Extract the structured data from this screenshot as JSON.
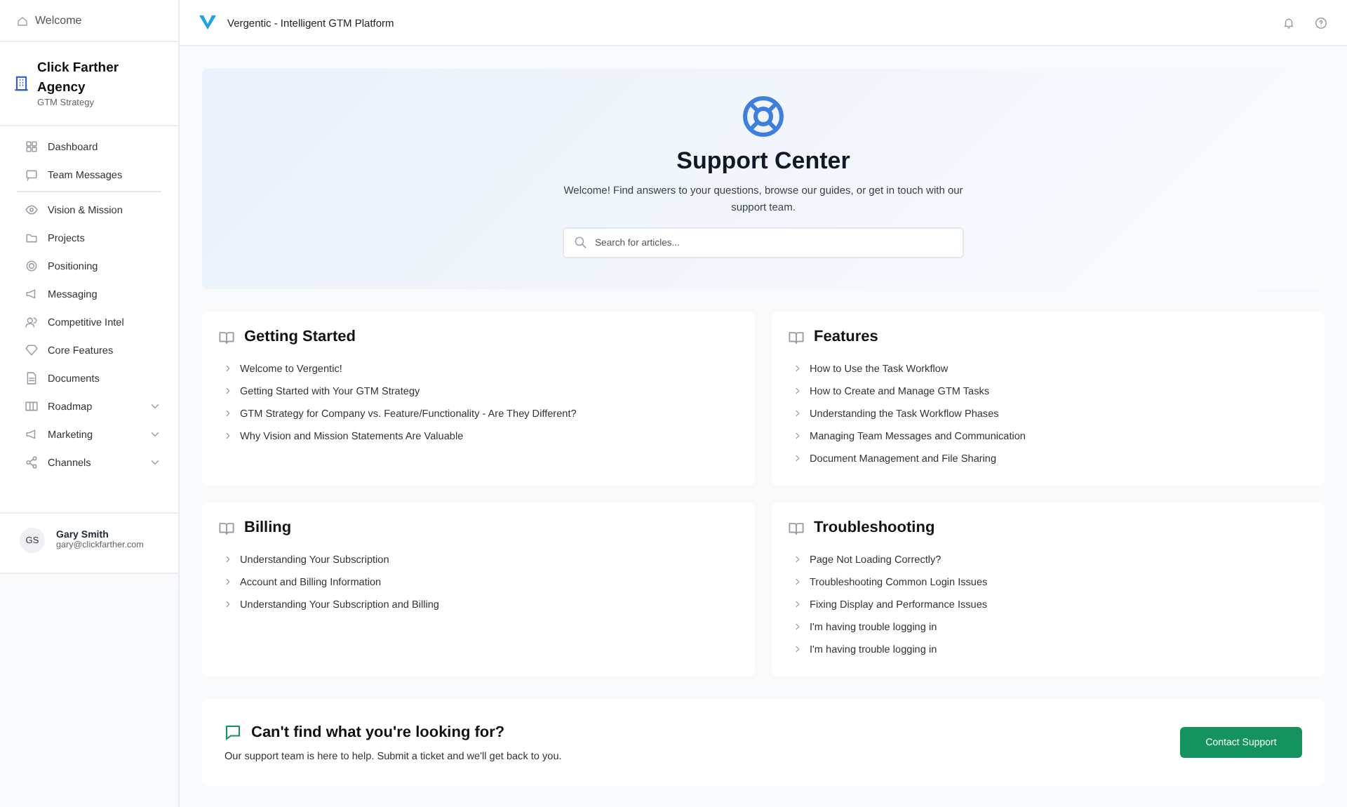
{
  "sidebar": {
    "welcome": "Welcome",
    "org": {
      "name": "Click Farther Agency",
      "subtitle": "GTM Strategy"
    },
    "nav_top": [
      {
        "label": "Dashboard"
      },
      {
        "label": "Team Messages"
      }
    ],
    "nav_main": [
      {
        "label": "Vision & Mission",
        "kind": "link"
      },
      {
        "label": "Projects",
        "kind": "link"
      },
      {
        "label": "Positioning",
        "kind": "link"
      },
      {
        "label": "Messaging",
        "kind": "link"
      },
      {
        "label": "Competitive Intel",
        "kind": "link"
      },
      {
        "label": "Core Features",
        "kind": "link"
      },
      {
        "label": "Documents",
        "kind": "link"
      },
      {
        "label": "Roadmap",
        "kind": "group"
      },
      {
        "label": "Marketing",
        "kind": "group"
      },
      {
        "label": "Channels",
        "kind": "group"
      }
    ],
    "user": {
      "initials": "GS",
      "name": "Gary Smith",
      "email": "gary@clickfarther.com"
    }
  },
  "topbar": {
    "title": "Vergentic - Intelligent GTM Platform"
  },
  "hero": {
    "title": "Support Center",
    "text": "Welcome! Find answers to your questions, browse our guides, or get in touch with our support team.",
    "search": {
      "placeholder": "Search for articles..."
    }
  },
  "sections": [
    {
      "title": "Getting Started",
      "articles": [
        "Welcome to Vergentic!",
        "Getting Started with Your GTM Strategy",
        "GTM Strategy for Company vs. Feature/Functionality - Are They Different?",
        "Why Vision and Mission Statements Are Valuable"
      ]
    },
    {
      "title": "Features",
      "articles": [
        "How to Use the Task Workflow",
        "How to Create and Manage GTM Tasks",
        "Understanding the Task Workflow Phases",
        "Managing Team Messages and Communication",
        "Document Management and File Sharing"
      ]
    },
    {
      "title": "Billing",
      "articles": [
        "Understanding Your Subscription",
        "Account and Billing Information",
        "Understanding Your Subscription and Billing"
      ]
    },
    {
      "title": "Troubleshooting",
      "articles": [
        "Page Not Loading Correctly?",
        "Troubleshooting Common Login Issues",
        "Fixing Display and Performance Issues",
        "I'm having trouble logging in",
        "I'm having trouble logging in"
      ]
    }
  ],
  "contact": {
    "title": "Can't find what you're looking for?",
    "text": "Our support team is here to help. Submit a ticket and we'll get back to you.",
    "button": "Contact Support"
  }
}
